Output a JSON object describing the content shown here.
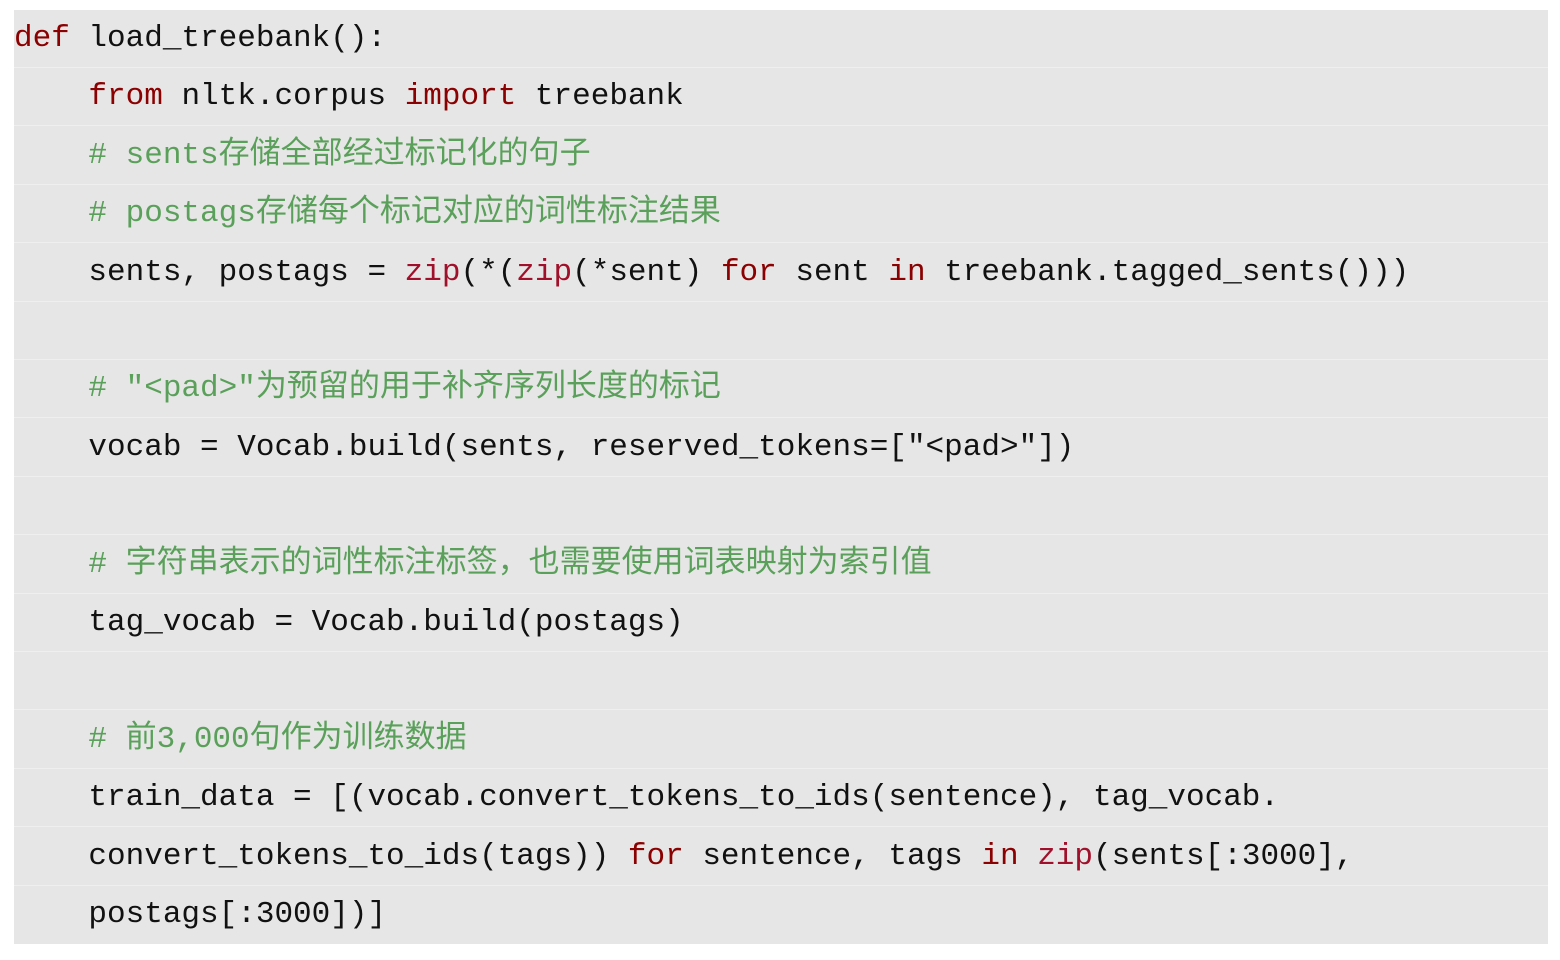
{
  "colors": {
    "background": "#e6e6e6",
    "text": "#111111",
    "keyword": "#8b0000",
    "builtin": "#a0102a",
    "comment": "#5aa05a"
  },
  "lines": [
    [
      [
        "kw",
        "def"
      ],
      [
        "pl",
        " load_treebank():"
      ]
    ],
    [
      [
        "pl",
        "    "
      ],
      [
        "kw",
        "from"
      ],
      [
        "pl",
        " nltk.corpus "
      ],
      [
        "kw",
        "import"
      ],
      [
        "pl",
        " treebank"
      ]
    ],
    [
      [
        "cm",
        "    # sents存储全部经过标记化的句子"
      ]
    ],
    [
      [
        "cm",
        "    # postags存储每个标记对应的词性标注结果"
      ]
    ],
    [
      [
        "pl",
        "    sents, postags = "
      ],
      [
        "bi",
        "zip"
      ],
      [
        "pl",
        "(*("
      ],
      [
        "bi",
        "zip"
      ],
      [
        "pl",
        "(*sent) "
      ],
      [
        "kw",
        "for"
      ],
      [
        "pl",
        " sent "
      ],
      [
        "kw",
        "in"
      ],
      [
        "pl",
        " treebank.tagged_sents()))"
      ]
    ],
    [],
    [
      [
        "cm",
        "    # \"<pad>\"为预留的用于补齐序列长度的标记"
      ]
    ],
    [
      [
        "pl",
        "    vocab = Vocab.build(sents, reserved_tokens=[\"<pad>\"])"
      ]
    ],
    [],
    [
      [
        "cm",
        "    # 字符串表示的词性标注标签，也需要使用词表映射为索引值"
      ]
    ],
    [
      [
        "pl",
        "    tag_vocab = Vocab.build(postags)"
      ]
    ],
    [],
    [
      [
        "cm",
        "    # 前3,000句作为训练数据"
      ]
    ],
    [
      [
        "pl",
        "    train_data = [(vocab.convert_tokens_to_ids(sentence), tag_vocab."
      ]
    ],
    [
      [
        "pl",
        "    convert_tokens_to_ids(tags)) "
      ],
      [
        "kw",
        "for"
      ],
      [
        "pl",
        " sentence, tags "
      ],
      [
        "kw",
        "in"
      ],
      [
        "pl",
        " "
      ],
      [
        "bi",
        "zip"
      ],
      [
        "pl",
        "(sents[:3000],"
      ]
    ],
    [
      [
        "pl",
        "    postags[:3000])]"
      ]
    ]
  ]
}
